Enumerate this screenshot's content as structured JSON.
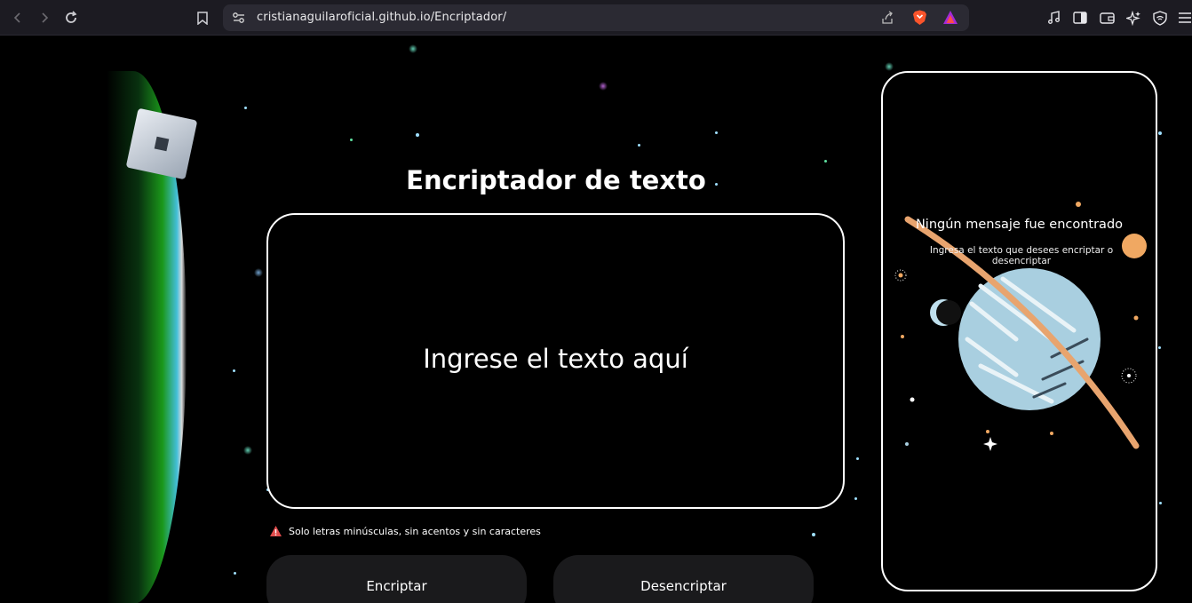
{
  "browser": {
    "url": "cristianaguilaroficial.github.io/Encriptador/"
  },
  "main": {
    "title": "Encriptador de texto",
    "input_placeholder": "Ingrese el texto aquí",
    "warning": "Solo letras minúsculas, sin acentos y sin caracteres",
    "encrypt_label": "Encriptar",
    "decrypt_label": "Desencriptar"
  },
  "result": {
    "title": "Ningún mensaje fue encontrado",
    "subtitle": "Ingresa el texto que desees encriptar o desencriptar"
  },
  "colors": {
    "background": "#000000",
    "button": "#1a1a1c",
    "border": "#ffffff",
    "warning_red": "#e04b4b"
  }
}
